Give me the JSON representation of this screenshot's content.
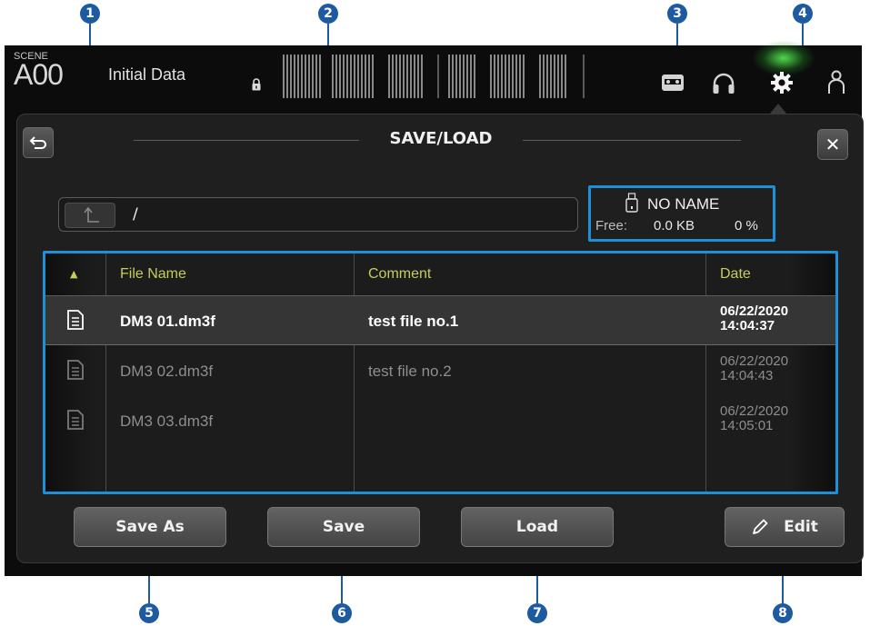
{
  "topbar": {
    "scene_caption": "SCENE",
    "scene_number": "A00",
    "scene_title": "Initial Data"
  },
  "dialog": {
    "title": "SAVE/LOAD",
    "back_icon": "return-arrow-icon",
    "close_label": "✕"
  },
  "path": {
    "up_icon": "folder-up-arrow-icon",
    "current": "/"
  },
  "usb": {
    "icon": "usb-drive-icon",
    "name": "NO NAME",
    "free_label": "Free:",
    "free_value": "0.0 KB",
    "free_percent": "0 %"
  },
  "file_list": {
    "sort_indicator": "▲",
    "columns": {
      "file_name": "File Name",
      "comment": "Comment",
      "date": "Date"
    },
    "rows": [
      {
        "file_name": "DM3 01.dm3f",
        "comment": "test file no.1",
        "date": "06/22/2020",
        "time": "14:04:37",
        "selected": true
      },
      {
        "file_name": "DM3 02.dm3f",
        "comment": "test file no.2",
        "date": "06/22/2020",
        "time": "14:04:43",
        "selected": false
      },
      {
        "file_name": "DM3 03.dm3f",
        "comment": "",
        "date": "06/22/2020",
        "time": "14:05:01",
        "selected": false
      }
    ]
  },
  "buttons": {
    "save_as": "Save As",
    "save": "Save",
    "load": "Load",
    "edit": "Edit"
  },
  "callouts": [
    "1",
    "2",
    "3",
    "4",
    "5",
    "6",
    "7",
    "8"
  ],
  "colors": {
    "callout": "#1e5aa0",
    "highlight_box": "#1e90d8",
    "header_text": "#c8cc5a",
    "active_glow": "#5aff5a"
  }
}
